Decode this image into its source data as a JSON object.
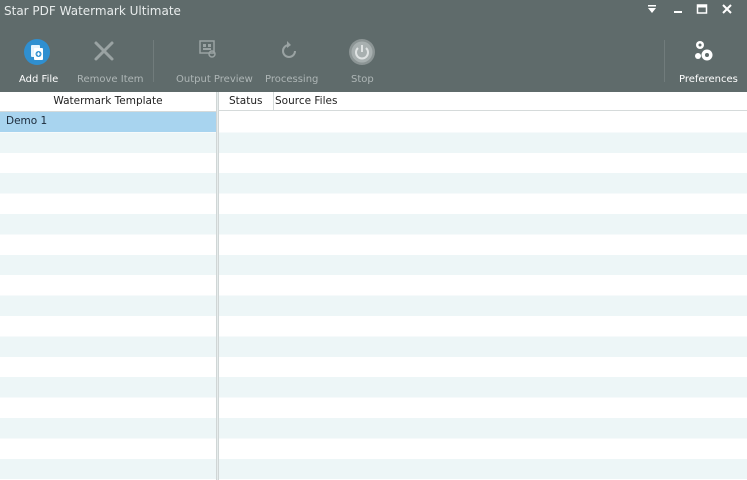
{
  "window": {
    "title": "Star PDF Watermark Ultimate",
    "controls": [
      "dropdown-icon",
      "minimize-icon",
      "maximize-icon",
      "close-icon"
    ]
  },
  "toolbar": {
    "add_file": "Add File",
    "remove_item": "Remove Item",
    "output_preview": "Output Preview",
    "processing": "Processing",
    "stop": "Stop",
    "preferences": "Preferences"
  },
  "templates_panel": {
    "header": "Watermark Template",
    "items": [
      "Demo 1"
    ]
  },
  "files_panel": {
    "columns": [
      "Status",
      "Source Files"
    ],
    "rows": []
  },
  "colors": {
    "chrome": "#5f6b6b",
    "accent": "#2f8fd0",
    "selection": "#a8d4ef",
    "alt_row": "#edf6f7"
  }
}
